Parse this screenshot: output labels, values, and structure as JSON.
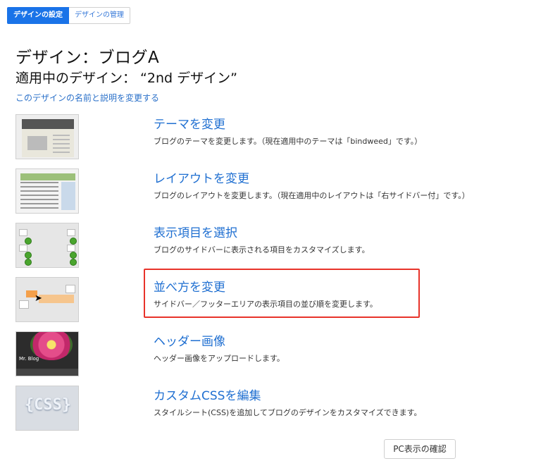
{
  "tabs": [
    {
      "label": "デザインの設定",
      "active": true
    },
    {
      "label": "デザインの管理",
      "active": false
    }
  ],
  "heading": {
    "title": "デザイン：ブログA",
    "subtitle": "適用中のデザイン： “2nd デザイン”",
    "rename_link": "このデザインの名前と説明を変更する"
  },
  "items": [
    {
      "title": "テーマを変更",
      "description": "ブログのテーマを変更します。（現在適用中のテーマは「bindweed」です。）",
      "thumbnail_icon": "theme-thumbnail"
    },
    {
      "title": "レイアウトを変更",
      "description": "ブログのレイアウトを変更します。（現在適用中のレイアウトは「右サイドバー付」です。）",
      "thumbnail_icon": "layout-thumbnail"
    },
    {
      "title": "表示項目を選択",
      "description": "ブログのサイドバーに表示される項目をカスタマイズします。",
      "thumbnail_icon": "checklist-thumbnail"
    },
    {
      "title": "並べ方を変更",
      "description": "サイドバー／フッターエリアの表示項目の並び順を変更します。",
      "thumbnail_icon": "drag-order-thumbnail",
      "highlighted": true
    },
    {
      "title": "ヘッダー画像",
      "description": "ヘッダー画像をアップロードします。",
      "thumbnail_icon": "header-image-thumbnail",
      "thumbnail_text": "Mr. Blog"
    },
    {
      "title": "カスタムCSSを編集",
      "description": "スタイルシート(CSS)を追加してブログのデザインをカスタマイズできます。",
      "thumbnail_icon": "css-thumbnail",
      "thumbnail_text": "{CSS}"
    }
  ],
  "confirm_button": "PC表示の確認",
  "colors": {
    "accent": "#1a73e8",
    "link": "#1f6fd1",
    "highlight": "#e8332a"
  }
}
